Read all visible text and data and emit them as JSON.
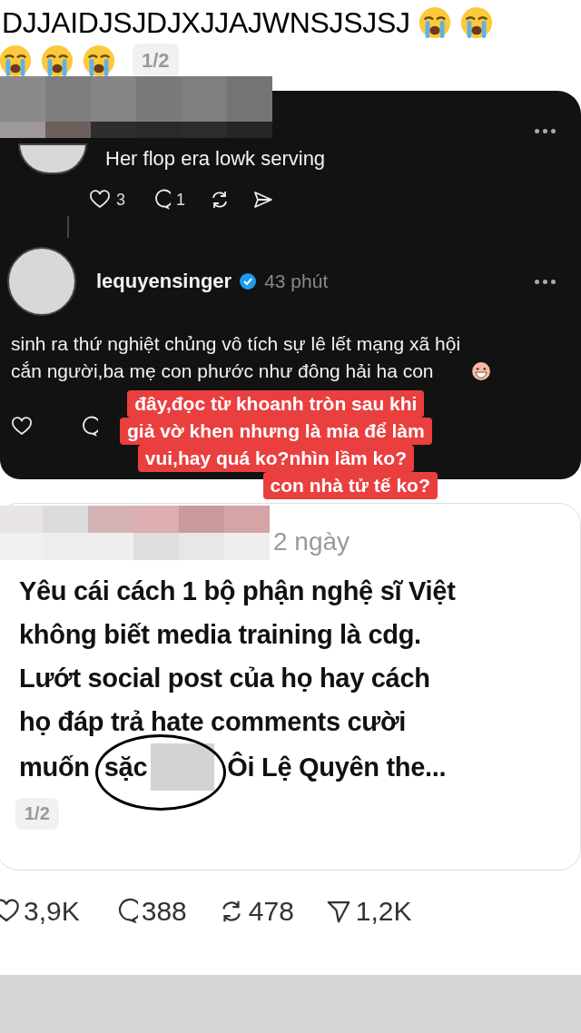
{
  "header": {
    "text": "DJJAIDJSJDJXJJAJWNSJSJSJ",
    "page": "1/2"
  },
  "thread": {
    "comments": [
      {
        "kind": "reply",
        "text": "Her flop era lowk serving",
        "likes": "3",
        "replies": "1"
      },
      {
        "kind": "author",
        "username": "lequyensinger",
        "verified": true,
        "time": "43 phút",
        "text": "sinh ra thứ nghiệt chủng vô tích sự lê lết mạng xã hội cắn người,ba mẹ con phước như đông hải ha con"
      }
    ]
  },
  "caption": {
    "lines": [
      "đây,đọc từ khoanh tròn sau khi",
      "giả vờ khen nhưng là mỉa để làm",
      "vui,hay quá ko?nhìn lầm ko?",
      "con nhà tử tế ko?"
    ]
  },
  "post": {
    "time": "2 ngày",
    "lines": [
      "Yêu cái cách 1 bộ phận nghệ sĩ Việt",
      "không biết media training là cdg.",
      "Lướt social post của họ hay cách",
      "họ đáp trả hate comments cười"
    ],
    "last_line": {
      "before": "muốn",
      "circled": "sặc",
      "after": "Ôi Lệ Quyên the..."
    },
    "page": "1/2"
  },
  "stats": [
    {
      "kind": "like",
      "count": "3,9K"
    },
    {
      "kind": "reply",
      "count": "388"
    },
    {
      "kind": "repost",
      "count": "478"
    },
    {
      "kind": "share",
      "count": "1,2K"
    }
  ]
}
